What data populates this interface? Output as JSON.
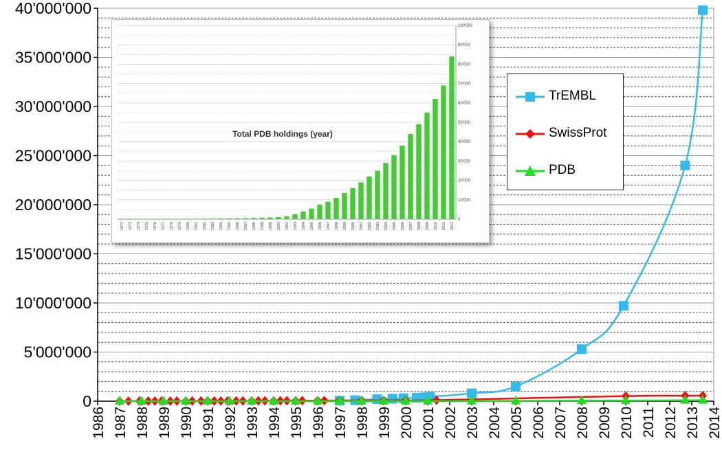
{
  "chart_data": [
    {
      "type": "line",
      "title": "",
      "xlabel": "",
      "ylabel": "",
      "xlim": [
        1986,
        2014
      ],
      "ylim": [
        0,
        40000000
      ],
      "y_tick_labels": [
        "0",
        "5'000'000",
        "10'000'000",
        "15'000'000",
        "20'000'000",
        "25'000'000",
        "30'000'000",
        "35'000'000",
        "40'000'000"
      ],
      "y_ticks": [
        0,
        5000000,
        10000000,
        15000000,
        20000000,
        25000000,
        30000000,
        35000000,
        40000000
      ],
      "x_tick_labels": [
        "1986",
        "1987",
        "1988",
        "1989",
        "1990",
        "1991",
        "1992",
        "1993",
        "1994",
        "1995",
        "1996",
        "1997",
        "1998",
        "1999",
        "2000",
        "2001",
        "2002",
        "2003",
        "2004",
        "2005",
        "2006",
        "2007",
        "2008",
        "2009",
        "2010",
        "2011",
        "2012",
        "2013",
        "2014"
      ],
      "grid": true,
      "legend_position": "right",
      "series": [
        {
          "name": "TrEMBL",
          "color": "#33BBEE",
          "marker": "square",
          "x": [
            1997.0,
            1997.7,
            1998.7,
            1999.4,
            1999.9,
            2000.5,
            2000.9,
            2001.1,
            2003.0,
            2005.0,
            2008.0,
            2009.9,
            2012.7,
            2013.5
          ],
          "y": [
            50000,
            100000,
            200000,
            250000,
            300000,
            350000,
            400000,
            450000,
            800000,
            1500000,
            5300000,
            9700000,
            24000000,
            39800000
          ]
        },
        {
          "name": "SwissProt",
          "color": "#EE1111",
          "marker": "diamond",
          "x": [
            1987.0,
            1987.4,
            1987.9,
            1988.3,
            1988.6,
            1988.9,
            1989.3,
            1989.6,
            1990.0,
            1990.3,
            1990.7,
            1991.0,
            1991.3,
            1991.6,
            1991.9,
            1992.3,
            1992.6,
            1993.0,
            1993.3,
            1993.6,
            1994.0,
            1994.3,
            1994.6,
            1995.0,
            1995.3,
            1996.0,
            1996.3,
            1997.0,
            1998.0,
            1999.0,
            2000.0,
            2001.4,
            2010.0,
            2012.7,
            2013.5
          ],
          "y": [
            5000,
            6000,
            7000,
            8000,
            9000,
            10000,
            11000,
            12000,
            13000,
            14000,
            16000,
            17000,
            19000,
            20000,
            21000,
            22000,
            25000,
            28000,
            31000,
            35000,
            38000,
            40000,
            43000,
            47000,
            52000,
            57000,
            59000,
            70000,
            75000,
            80000,
            95000,
            101000,
            520000,
            550000,
            560000
          ]
        },
        {
          "name": "PDB",
          "color": "#22DD22",
          "marker": "triangle",
          "x": [
            1987.0,
            1988.0,
            1989.0,
            1990.0,
            1991.0,
            1992.0,
            1993.0,
            1994.0,
            1995.0,
            1996.0,
            1997.0,
            1998.0,
            1999.0,
            2000.0,
            2001.0,
            2003.0,
            2005.0,
            2008.0,
            2010.0,
            2012.7,
            2013.5
          ],
          "y": [
            300,
            400,
            500,
            700,
            900,
            1000,
            1200,
            1600,
            2000,
            3000,
            5000,
            7000,
            9000,
            12000,
            15000,
            21000,
            30000,
            50000,
            65000,
            88000,
            95000
          ]
        }
      ]
    },
    {
      "type": "bar",
      "title": "Total PDB holdings (year)",
      "xlabel": "",
      "ylabel": "",
      "ylim": [
        0,
        100000
      ],
      "y_ticks": [
        0,
        10000,
        20000,
        30000,
        40000,
        50000,
        60000,
        70000,
        80000,
        90000,
        100000
      ],
      "y_tick_labels": [
        "0",
        "10'000",
        "20'000",
        "30'000",
        "40'000",
        "50'000",
        "60'000",
        "70'000",
        "80'000",
        "90'000",
        "100'000"
      ],
      "color": "#44CC33",
      "categories": [
        "1972",
        "1973",
        "1974",
        "1975",
        "1976",
        "1977",
        "1978",
        "1979",
        "1980",
        "1981",
        "1982",
        "1983",
        "1984",
        "1985",
        "1986",
        "1987",
        "1988",
        "1989",
        "1990",
        "1991",
        "1992",
        "1993",
        "1994",
        "1995",
        "1996",
        "1997",
        "1998",
        "1999",
        "2000",
        "2001",
        "2002",
        "2003",
        "2004",
        "2005",
        "2006",
        "2007",
        "2008",
        "2009",
        "2010",
        "2011",
        "2012"
      ],
      "values": [
        13,
        20,
        30,
        50,
        70,
        100,
        120,
        150,
        180,
        220,
        250,
        300,
        350,
        400,
        450,
        500,
        600,
        750,
        900,
        1100,
        1500,
        2500,
        4000,
        5500,
        7500,
        9000,
        11000,
        13500,
        16000,
        19000,
        22000,
        25000,
        29000,
        33000,
        38000,
        44000,
        49000,
        55000,
        62000,
        69000,
        84000
      ]
    }
  ]
}
